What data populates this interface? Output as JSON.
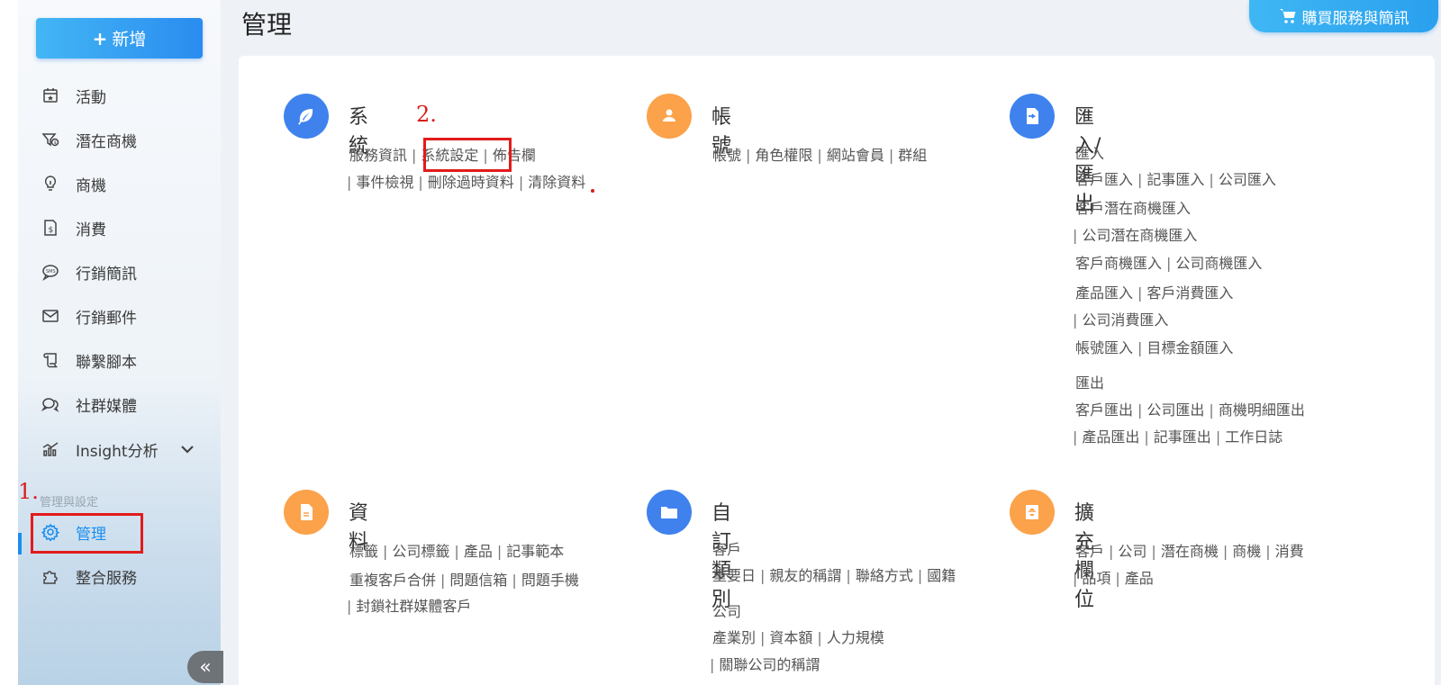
{
  "sidebar": {
    "new_button": "新增",
    "items": [
      {
        "label": "活動"
      },
      {
        "label": "潛在商機"
      },
      {
        "label": "商機"
      },
      {
        "label": "消費"
      },
      {
        "label": "行銷簡訊"
      },
      {
        "label": "行銷郵件"
      },
      {
        "label": "聯繫腳本"
      },
      {
        "label": "社群媒體"
      },
      {
        "label": "Insight分析"
      }
    ],
    "section_label": "管理與設定",
    "admin_items": [
      {
        "label": "管理"
      },
      {
        "label": "整合服務"
      }
    ],
    "collapse": "«"
  },
  "header": {
    "title": "管理",
    "buy_button": "購買服務與簡訊"
  },
  "annotations": {
    "step1": "1.",
    "step2": "2."
  },
  "sections": {
    "system": {
      "title": "系統",
      "l1": [
        "服務資訊",
        "系統設定",
        "佈告欄"
      ],
      "l2": [
        "事件檢視",
        "刪除過時資料",
        "清除資料"
      ]
    },
    "account": {
      "title": "帳號",
      "l1": [
        "帳號",
        "角色權限",
        "網站會員",
        "群組"
      ]
    },
    "io": {
      "title": "匯入/匯出",
      "import_label": "匯入",
      "i1": [
        "客戶匯入",
        "記事匯入",
        "公司匯入"
      ],
      "i2": [
        "客戶潛在商機匯入"
      ],
      "i3": [
        "公司潛在商機匯入"
      ],
      "i4": [
        "客戶商機匯入",
        "公司商機匯入"
      ],
      "i5": [
        "產品匯入",
        "客戶消費匯入"
      ],
      "i6": [
        "公司消費匯入"
      ],
      "i7": [
        "帳號匯入",
        "目標金額匯入"
      ],
      "export_label": "匯出",
      "e1": [
        "客戶匯出",
        "公司匯出",
        "商機明細匯出"
      ],
      "e2": [
        "產品匯出",
        "記事匯出",
        "工作日誌"
      ]
    },
    "data": {
      "title": "資料",
      "l1": [
        "標籤",
        "公司標籤",
        "產品",
        "記事範本"
      ],
      "l2": [
        "重複客戶合併",
        "問題信箱",
        "問題手機"
      ],
      "l3": [
        "封鎖社群媒體客戶"
      ]
    },
    "custom": {
      "title": "自訂類別",
      "customer_label": "客戶",
      "c1": [
        "重要日",
        "親友的稱謂",
        "聯絡方式",
        "國籍"
      ],
      "company_label": "公司",
      "c2": [
        "產業別",
        "資本額",
        "人力規模"
      ],
      "c3": [
        "關聯公司的稱謂"
      ]
    },
    "ext": {
      "title": "擴充欄位",
      "l1": [
        "客戶",
        "公司",
        "潛在商機",
        "商機",
        "消費"
      ],
      "l2": [
        "品項",
        "產品"
      ]
    }
  },
  "colors": {
    "accent": "#1a8ef0",
    "blue_icon": "#3f82ee",
    "orange_icon": "#fba24a",
    "annotation": "#e21b1b"
  }
}
